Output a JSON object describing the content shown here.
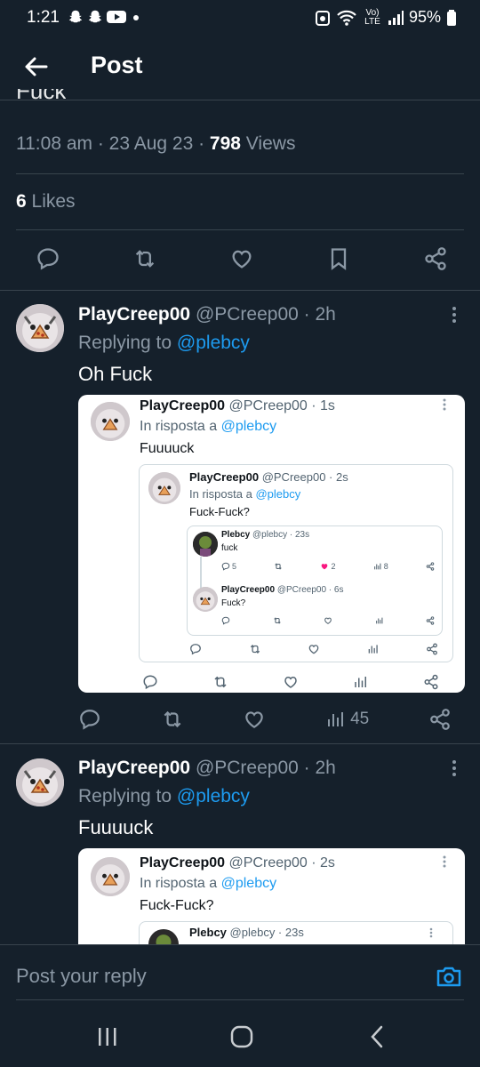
{
  "status_bar": {
    "time": "1:21",
    "network": "Vo) LTE",
    "battery": "95%"
  },
  "header": {
    "title": "Post"
  },
  "tweet": {
    "cut_text": "Fuck",
    "time": "11:08 am · 23 Aug 23 · ",
    "views_count": "798",
    "views_label": " Views",
    "likes_count": "6",
    "likes_label": " Likes"
  },
  "replies": [
    {
      "name": "PlayCreep00",
      "handle": "@PCreep00 · 2h",
      "replying_prefix": "Replying to ",
      "replying_to": "@plebcy",
      "text": "Oh Fuck",
      "views": "45",
      "screenshot": {
        "name": "PlayCreep00",
        "handle": "@PCreep00 · 1s",
        "reply_prefix": "In risposta a ",
        "reply_to": "@plebcy",
        "text": "Fuuuuck",
        "inner": {
          "name": "PlayCreep00",
          "handle": "@PCreep00 · 2s",
          "reply_prefix": "In risposta a ",
          "reply_to": "@plebcy",
          "text": "Fuck-Fuck?",
          "thread": [
            {
              "name": "Plebcy",
              "handle": "@plebcy · 23s",
              "text": "fuck",
              "replies": "5",
              "likes": "2",
              "views": "8"
            },
            {
              "name": "PlayCreep00",
              "handle": "@PCreep00 · 6s",
              "text": "Fuck?"
            }
          ]
        }
      }
    },
    {
      "name": "PlayCreep00",
      "handle": "@PCreep00 · 2h",
      "replying_prefix": "Replying to ",
      "replying_to": "@plebcy",
      "text": "Fuuuuck",
      "screenshot": {
        "name": "PlayCreep00",
        "handle": "@PCreep00 · 2s",
        "reply_prefix": "In risposta a ",
        "reply_to": "@plebcy",
        "text": "Fuck-Fuck?",
        "inner": {
          "name": "Plebcy",
          "handle": "@plebcy · 23s"
        }
      }
    }
  ],
  "reply_input": {
    "placeholder": "Post your reply"
  },
  "colors": {
    "background": "#15202b",
    "accent": "#1d9bf0",
    "like_pink": "#f91880"
  }
}
